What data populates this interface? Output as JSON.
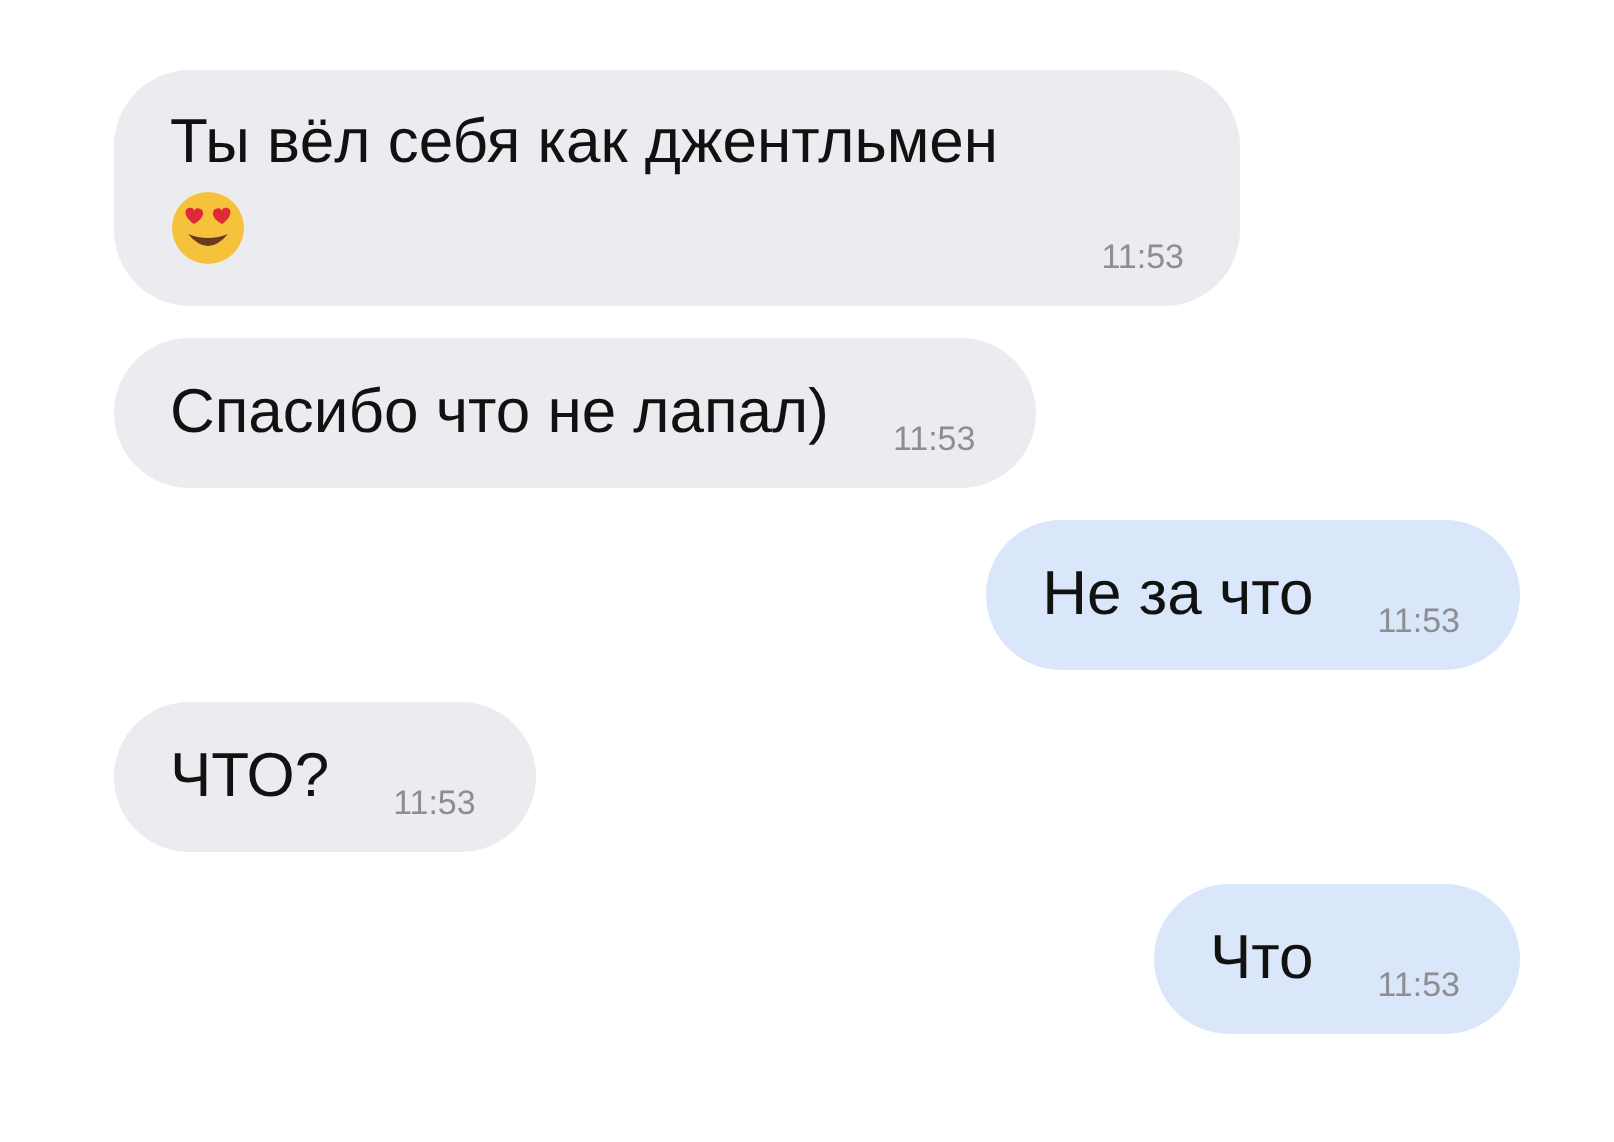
{
  "messages": [
    {
      "kind": "incoming",
      "text": "Ты вёл себя как джентльмен",
      "emoji": true,
      "time": "11:53"
    },
    {
      "kind": "incoming",
      "text": "Спасибо что не лапал)",
      "emoji": false,
      "time": "11:53"
    },
    {
      "kind": "outgoing",
      "text": "Не за что",
      "emoji": false,
      "time": "11:53"
    },
    {
      "kind": "incoming",
      "text": "ЧТО?",
      "emoji": false,
      "time": "11:53"
    },
    {
      "kind": "outgoing",
      "text": "Что",
      "emoji": false,
      "time": "11:53"
    }
  ]
}
